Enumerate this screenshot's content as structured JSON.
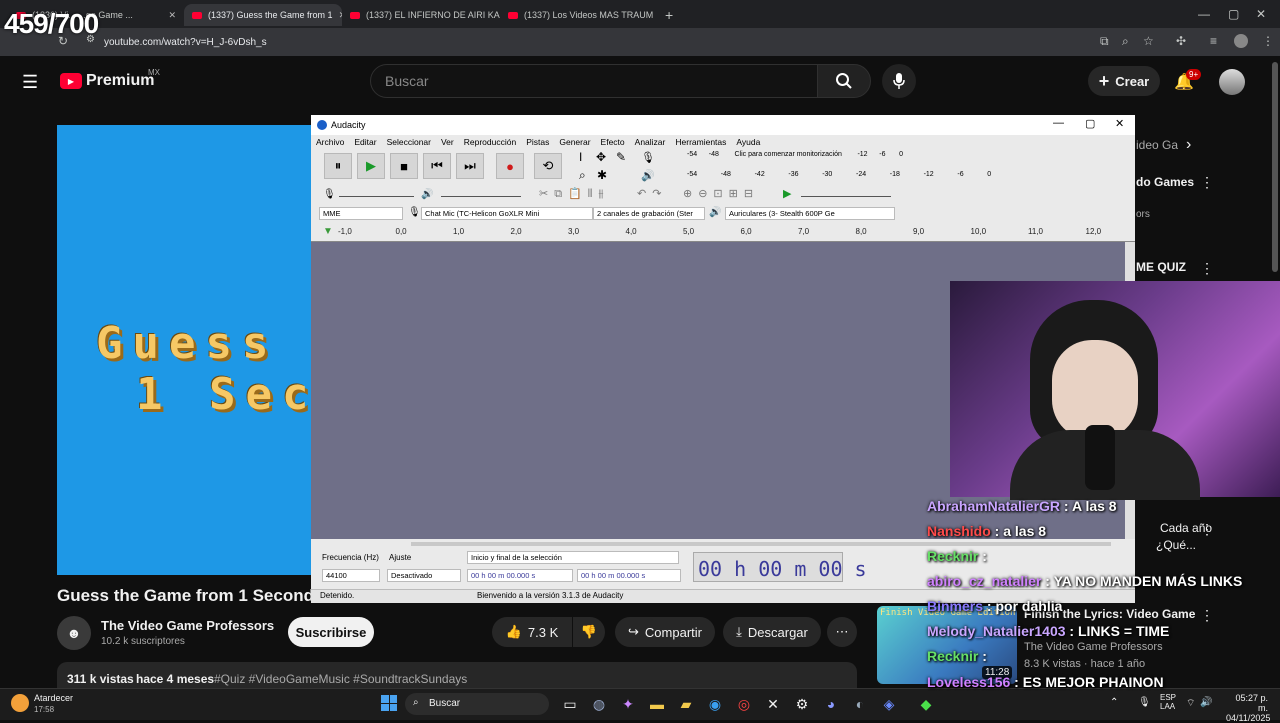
{
  "overlay_counter": "459/700",
  "browser": {
    "tabs": [
      {
        "label": "(1336) Vi... ...go Game ..."
      },
      {
        "label": "(1337) Guess the Game from 1"
      },
      {
        "label": "(1337) EL INFIERNO DE AIRI KA"
      },
      {
        "label": "(1337) Los Videos MAS TRAUM"
      }
    ],
    "url": "youtube.com/watch?v=H_J-6vDsh_s"
  },
  "youtube": {
    "logo": "Premium",
    "region": "MX",
    "search_placeholder": "Buscar",
    "create_label": "Crear",
    "notif_badge": "9+",
    "video_text_line1": "Guess",
    "video_text_line2": "1 Sec",
    "video_title": "Guess the Game from 1 Second of",
    "channel_name": "The Video Game Professors",
    "subscribers": "10.2 k suscriptores",
    "subscribe_label": "Suscribirse",
    "likes": "7.3 K",
    "share_label": "Compartir",
    "download_label": "Descargar",
    "views": "311 k vistas",
    "age": "hace 4 meses",
    "hashtags": "#Quiz #VideoGameMusic #SoundtrackSundays",
    "right_col": {
      "chip": "ideo Ga",
      "item1": "do Games",
      "item1b": "ors",
      "item2": "ME QUIZ",
      "item3_title": "Cada año",
      "item3_sub": "¿Qué...",
      "item4_title": "Finish the Lyrics: Video Game",
      "item4_channel": "The Video Game Professors",
      "item4_meta": "8.3 K vistas · hace 1 año",
      "thumb_duration": "11:28",
      "thumb_caption": "Finish Video Game Edition"
    }
  },
  "audacity": {
    "title": "Audacity",
    "menu": [
      "Archivo",
      "Editar",
      "Seleccionar",
      "Ver",
      "Reproducción",
      "Pistas",
      "Generar",
      "Efecto",
      "Analizar",
      "Herramientas",
      "Ayuda"
    ],
    "monitor_text": "Clic para comenzar monitorización",
    "meter_rec": [
      "-54",
      "-48",
      "-12",
      "-6",
      "0"
    ],
    "meter_play": [
      "-54",
      "-48",
      "-42",
      "-36",
      "-30",
      "-24",
      "-18",
      "-12",
      "-6",
      "0"
    ],
    "host": "MME",
    "rec_device": "Chat Mic (TC-Helicon GoXLR Mini",
    "channels": "2 canales de grabación (Ster",
    "play_device": "Auriculares (3- Stealth 600P Ge",
    "ruler_ticks": [
      "-1,0",
      "0,0",
      "1,0",
      "2,0",
      "3,0",
      "4,0",
      "5,0",
      "6,0",
      "7,0",
      "8,0",
      "9,0",
      "10,0",
      "11,0",
      "12,0"
    ],
    "rate_label": "Frecuencia (Hz)",
    "rate_value": "44100",
    "snap_label": "Ajuste",
    "snap_value": "Desactivado",
    "sel_label": "Inicio y final de la selección",
    "sel_start": "00 h 00 m 00.000 s",
    "sel_end": "00 h 00 m 00.000 s",
    "time_display": "00 h 00 m 00 s",
    "status_left": "Detenido.",
    "status_right": "Bienvenido a la versión 3.1.3 de Audacity"
  },
  "chat": [
    {
      "user": "AbrahamNatalierGR",
      "msg": "A las 8",
      "color": "#c9a6ff"
    },
    {
      "user": "Nanshido",
      "msg": "a las 8",
      "color": "#ff4a4a"
    },
    {
      "user": "Recknir",
      "msg": "",
      "color": "#66e066"
    },
    {
      "user": "abiro_cz_natalier",
      "msg": "YA NO MANDEN MÁS LINKS",
      "color": "#d080ff"
    },
    {
      "user": "Binmers",
      "msg": "por dahlia",
      "color": "#8a7aff"
    },
    {
      "user": "Melody_Natalier1403",
      "msg": "LINKS = TIME",
      "color": "#c9a6ff"
    },
    {
      "user": "Recknir",
      "msg": "",
      "color": "#66e066"
    },
    {
      "user": "Loveless156",
      "msg": "ES MEJOR PHAINON",
      "color": "#d080ff"
    }
  ],
  "taskbar": {
    "weather": "Atardecer",
    "weather_time": "17:58",
    "search": "Buscar",
    "lang1": "ESP",
    "lang2": "LAA",
    "time": "05:27 p. m.",
    "date": "04/11/2025"
  }
}
